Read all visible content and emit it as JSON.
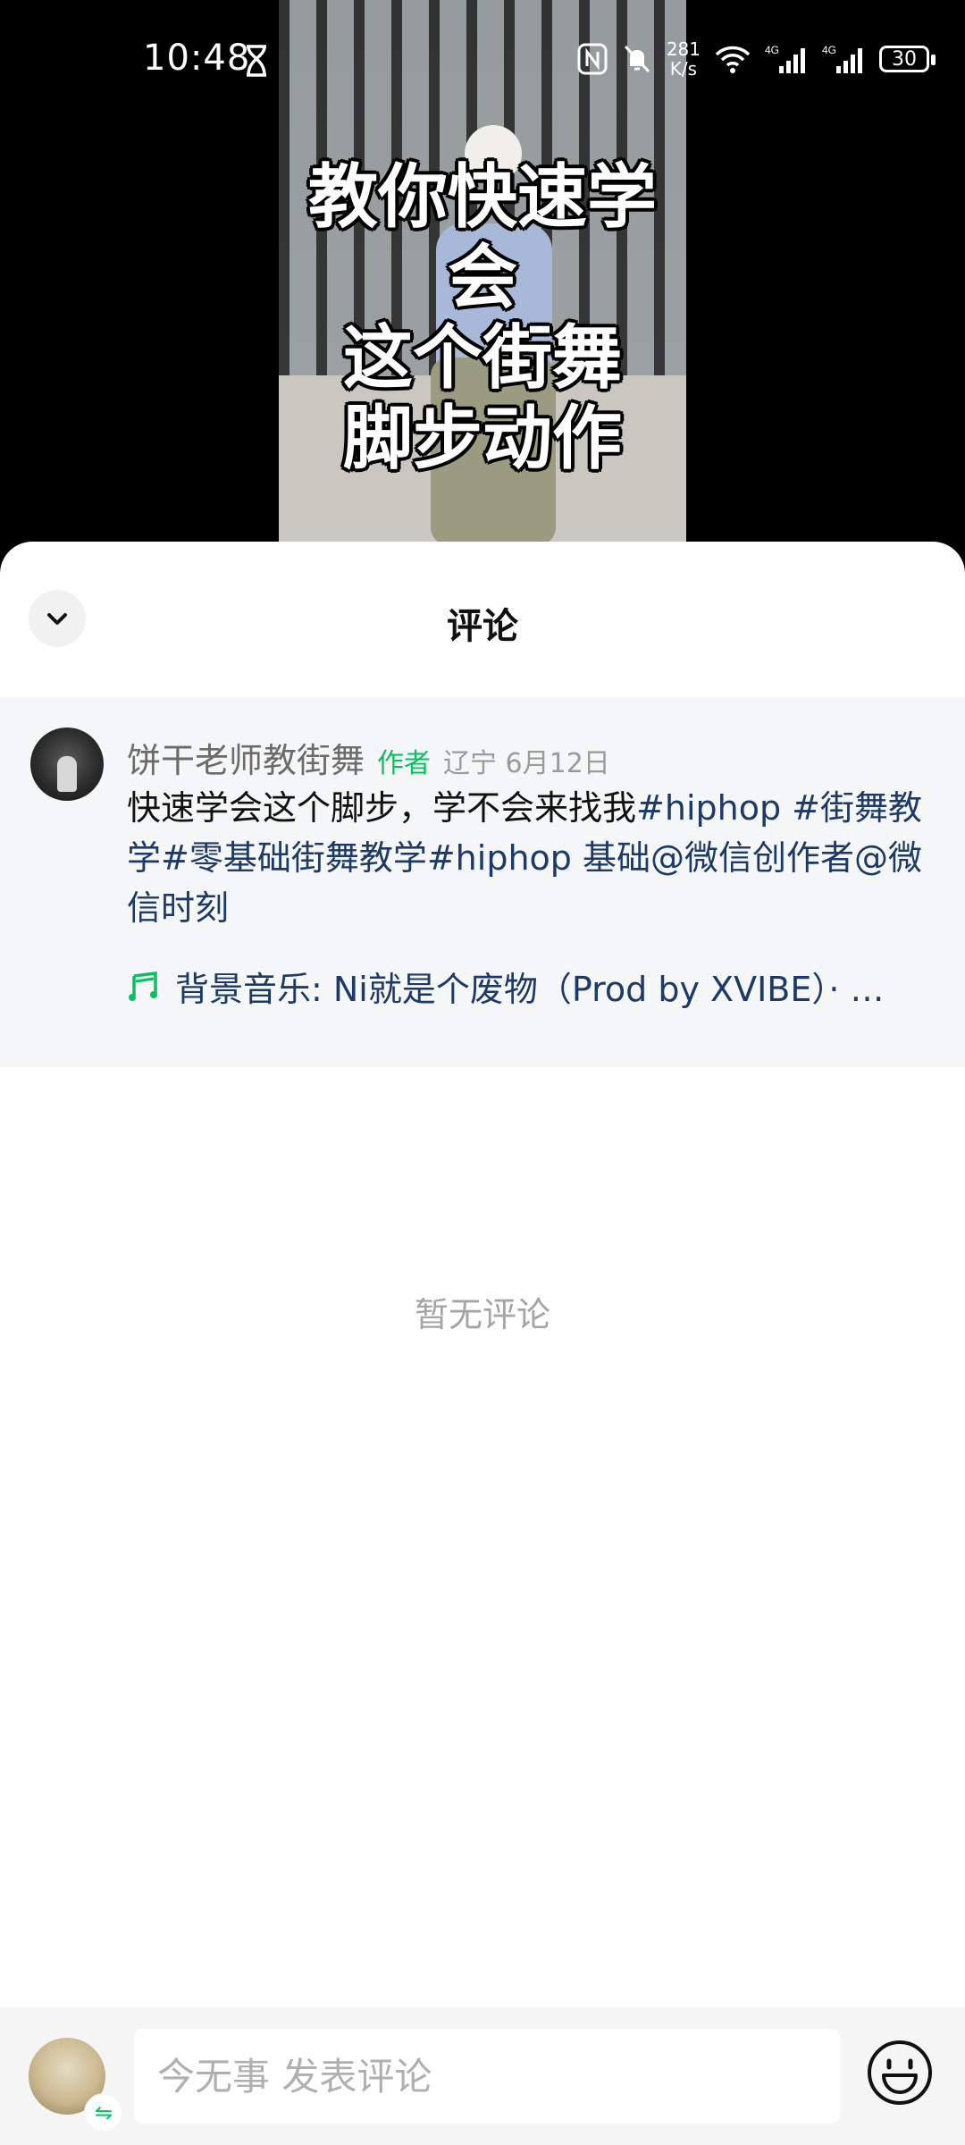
{
  "status_bar": {
    "time": "10:48",
    "net_speed_top": "281",
    "net_speed_bottom": "K/s",
    "battery": "30"
  },
  "video": {
    "caption": "教你快速学会\n这个街舞\n脚步动作"
  },
  "sheet": {
    "title": "评论"
  },
  "post": {
    "author": "饼干老师教街舞",
    "author_tag": "作者",
    "location_date": "辽宁 6月12日",
    "text_plain": "快速学会这个脚步，学不会来找我",
    "hashtags_mentions": "#hiphop #街舞教学#零基础街舞教学#hiphop 基础@微信创作者@微信时刻",
    "music": "背景音乐: Ni就是个废物（Prod by XVIBE）· …"
  },
  "comments": {
    "empty_text": "暂无评论"
  },
  "comment_bar": {
    "placeholder": "今无事 发表评论",
    "switch_badge": "⇋"
  },
  "colors": {
    "accent_green": "#07c160",
    "link_blue": "#1d3a66"
  },
  "icons": [
    "hourglass-icon",
    "nfc-icon",
    "mute-icon",
    "wifi-icon",
    "signal-icon",
    "battery-icon",
    "chevron-down-icon",
    "music-note-icon",
    "emoji-icon",
    "switch-icon"
  ]
}
